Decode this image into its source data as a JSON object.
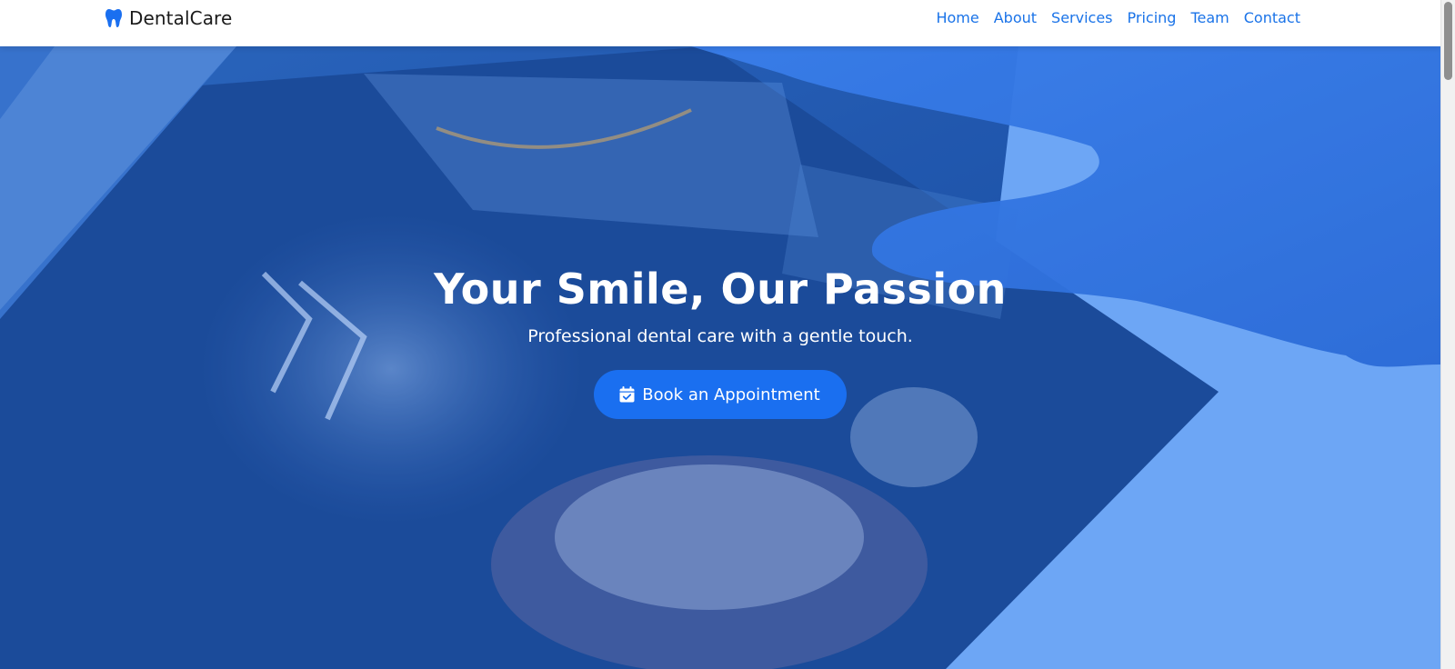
{
  "nav": {
    "brand": "DentalCare",
    "brand_icon": "tooth-icon",
    "links": [
      "Home",
      "About",
      "Services",
      "Pricing",
      "Team",
      "Contact"
    ]
  },
  "hero": {
    "title": "Your Smile, Our Passion",
    "subtitle": "Professional dental care with a gentle touch.",
    "cta_label": "Book an Appointment",
    "cta_icon": "calendar-check-icon"
  },
  "colors": {
    "accent": "#1a73e8",
    "button": "#1a6ff0",
    "overlay": "#2f7df0"
  }
}
